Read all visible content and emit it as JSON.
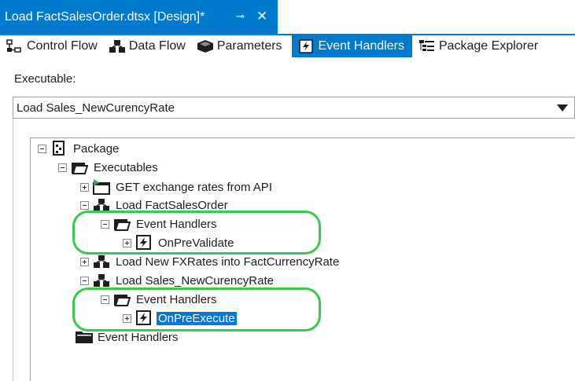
{
  "document_tab": {
    "title": "Load FactSalesOrder.dtsx [Design]*",
    "pin_glyph": "⊸",
    "close_glyph": "✕"
  },
  "designer_tabs": [
    {
      "label": "Control Flow",
      "icon": "control-flow-icon",
      "active": false
    },
    {
      "label": "Data Flow",
      "icon": "data-flow-icon",
      "active": false
    },
    {
      "label": "Parameters",
      "icon": "parameters-icon",
      "active": false
    },
    {
      "label": "Event Handlers",
      "icon": "event-handlers-icon",
      "active": true
    },
    {
      "label": "Package Explorer",
      "icon": "package-explorer-icon",
      "active": false
    }
  ],
  "executable": {
    "label": "Executable:",
    "selected": "Load Sales_NewCurencyRate"
  },
  "tree": {
    "package": "Package",
    "executables": "Executables",
    "get_rates": "GET exchange rates from API",
    "load_fact_sales": "Load FactSalesOrder",
    "eh_1": "Event Handlers",
    "on_pre_validate": "OnPreValidate",
    "load_new_fx": "Load New FXRates into FactCurrencyRate",
    "load_sales_new": "Load Sales_NewCurencyRate",
    "eh_2": "Event Handlers",
    "on_pre_execute": "OnPreExecute",
    "eh_root": "Event Handlers"
  },
  "colors": {
    "accent": "#007acc",
    "selection": "#0078d7",
    "highlight": "#3cc84c"
  }
}
